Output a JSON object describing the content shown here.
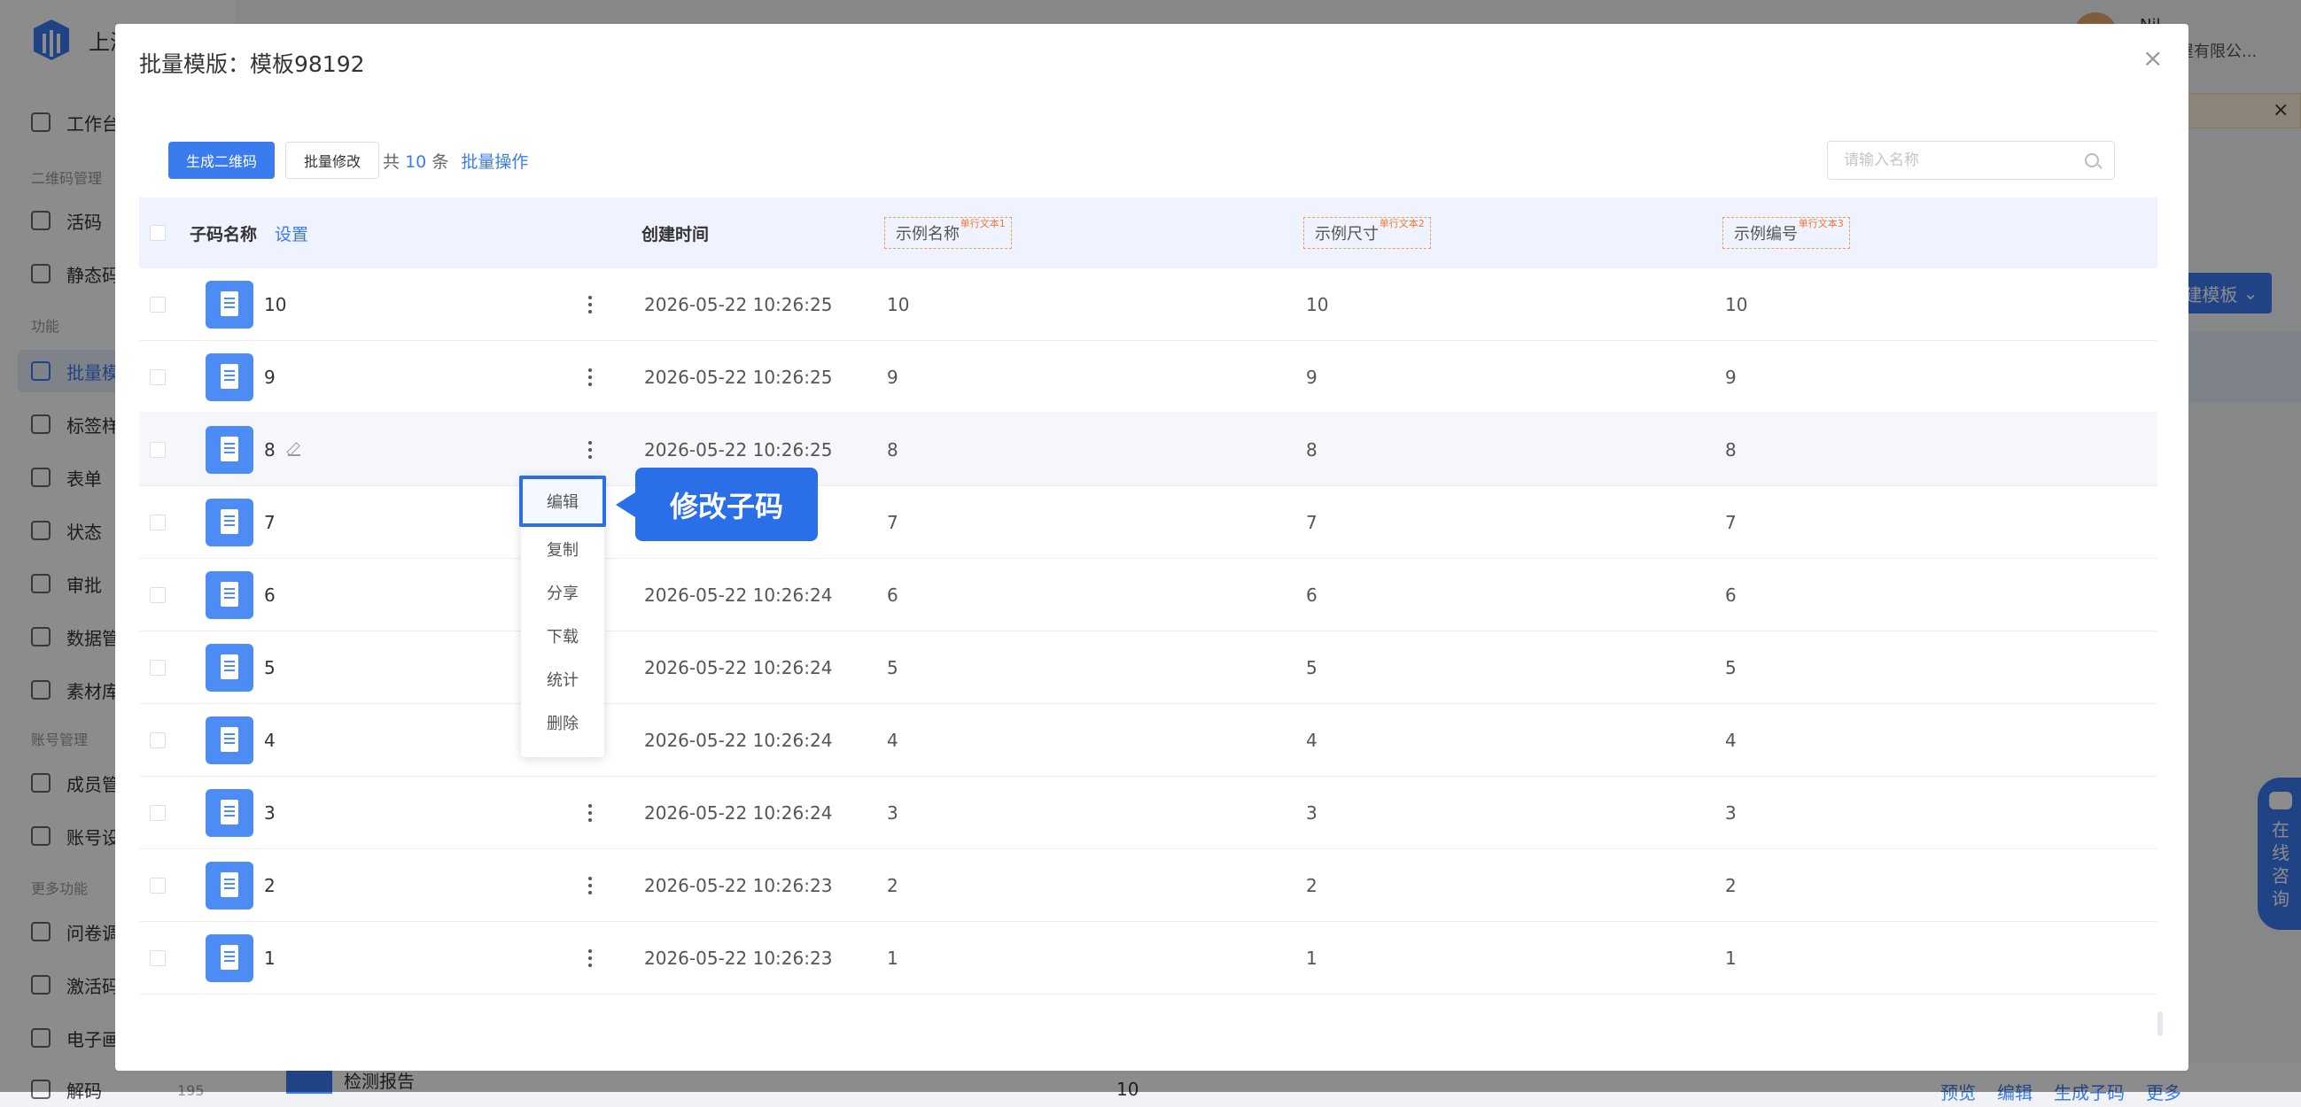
{
  "app": {
    "logo_text": "上海",
    "user_name": "Nil",
    "company": "木屋有限公...",
    "sidebar": {
      "sections": [
        "二维码管理",
        "功能",
        "账号管理",
        "更多功能"
      ],
      "items": [
        "工作台",
        "活码",
        "静态码",
        "批量模",
        "标签样",
        "表单",
        "状态",
        "审批",
        "数据管",
        "素材库",
        "成员管",
        "账号设",
        "问卷调",
        "激活码",
        "电子画",
        "解码"
      ],
      "last_count": "195"
    },
    "bg_button": "建模板",
    "chat": [
      "在",
      "线",
      "咨",
      "询"
    ],
    "bottom_row": {
      "name": "检测报告",
      "count": "10",
      "actions": [
        "预览",
        "编辑",
        "生成子码",
        "更多"
      ]
    }
  },
  "modal": {
    "title": "批量模版：模板98192",
    "close": "×",
    "toolbar": {
      "generate_label": "生成二维码",
      "batch_edit_label": "批量修改",
      "count_prefix": "共",
      "count": "10",
      "count_suffix": "条",
      "batch_op_label": "批量操作"
    },
    "search": {
      "placeholder": "请输入名称"
    },
    "columns": {
      "name": "子码名称",
      "settings": "设置",
      "created": "创建时间",
      "field1": "示例名称",
      "field1_tag": "单行文本1",
      "field2": "示例尺寸",
      "field2_tag": "单行文本2",
      "field3": "示例编号",
      "field3_tag": "单行文本3"
    },
    "rows": [
      {
        "name": "10",
        "time": "2026-05-22 10:26:25",
        "f1": "10",
        "f2": "10",
        "f3": "10"
      },
      {
        "name": "9",
        "time": "2026-05-22 10:26:25",
        "f1": "9",
        "f2": "9",
        "f3": "9"
      },
      {
        "name": "8",
        "time": "2026-05-22 10:26:25",
        "f1": "8",
        "f2": "8",
        "f3": "8"
      },
      {
        "name": "7",
        "time": "",
        "f1": "7",
        "f2": "7",
        "f3": "7"
      },
      {
        "name": "6",
        "time": "2026-05-22 10:26:24",
        "f1": "6",
        "f2": "6",
        "f3": "6"
      },
      {
        "name": "5",
        "time": "2026-05-22 10:26:24",
        "f1": "5",
        "f2": "5",
        "f3": "5"
      },
      {
        "name": "4",
        "time": "2026-05-22 10:26:24",
        "f1": "4",
        "f2": "4",
        "f3": "4"
      },
      {
        "name": "3",
        "time": "2026-05-22 10:26:24",
        "f1": "3",
        "f2": "3",
        "f3": "3"
      },
      {
        "name": "2",
        "time": "2026-05-22 10:26:23",
        "f1": "2",
        "f2": "2",
        "f3": "2"
      },
      {
        "name": "1",
        "time": "2026-05-22 10:26:23",
        "f1": "1",
        "f2": "1",
        "f3": "1"
      }
    ],
    "dropdown": [
      "编辑",
      "复制",
      "分享",
      "下载",
      "统计",
      "删除"
    ],
    "callout": "修改子码"
  },
  "colors": {
    "primary": "#3a7bf0",
    "header_bg": "#eef3ff",
    "tag_border": "#f0a050"
  }
}
